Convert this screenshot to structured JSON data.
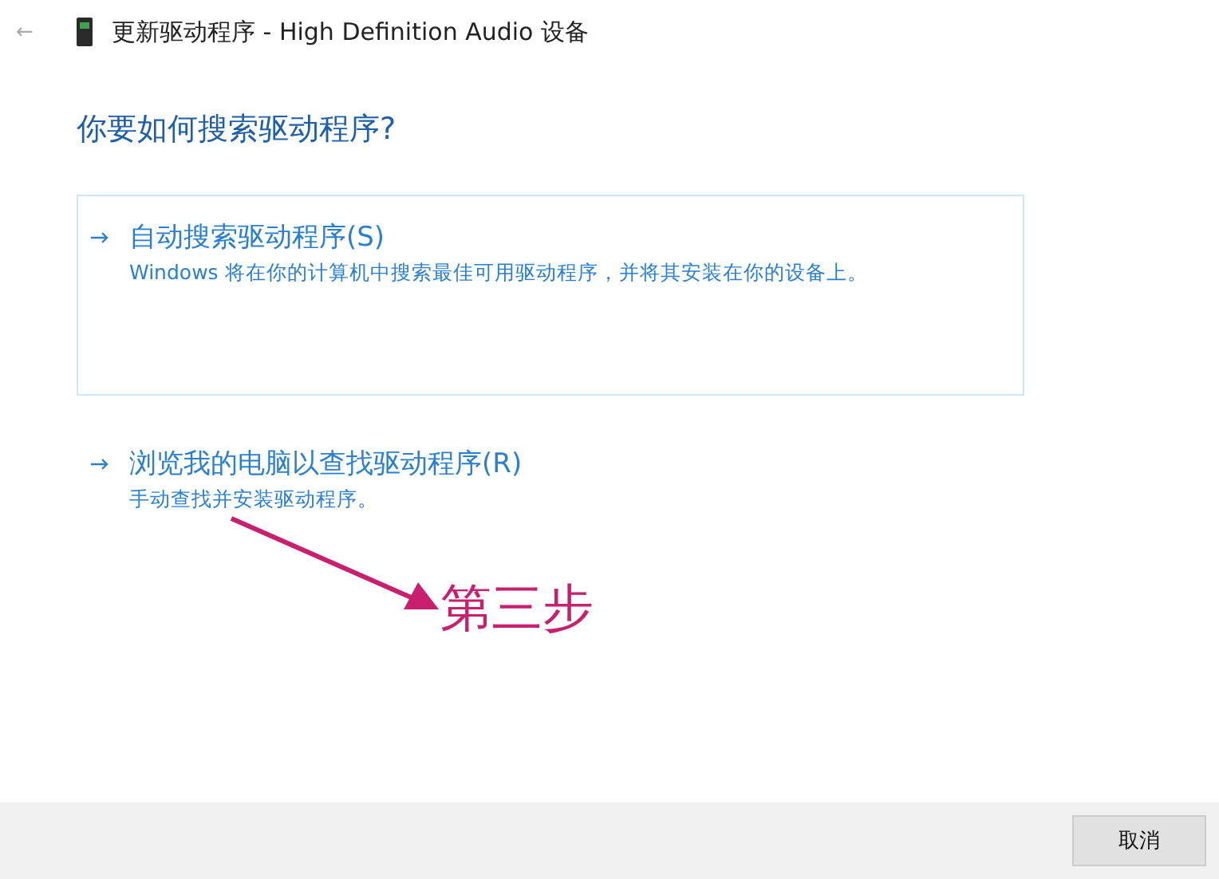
{
  "window": {
    "back": "←",
    "title": "更新驱动程序 - High Definition Audio 设备"
  },
  "heading": "你要如何搜索驱动程序?",
  "options": [
    {
      "title": "自动搜索驱动程序(S)",
      "description": "Windows 将在你的计算机中搜索最佳可用驱动程序，并将其安装在你的设备上。",
      "selected": true
    },
    {
      "title": "浏览我的电脑以查找驱动程序(R)",
      "description": "手动查找并安装驱动程序。",
      "selected": false
    }
  ],
  "annotation": {
    "label": "第三步"
  },
  "buttons": [
    "取消"
  ]
}
